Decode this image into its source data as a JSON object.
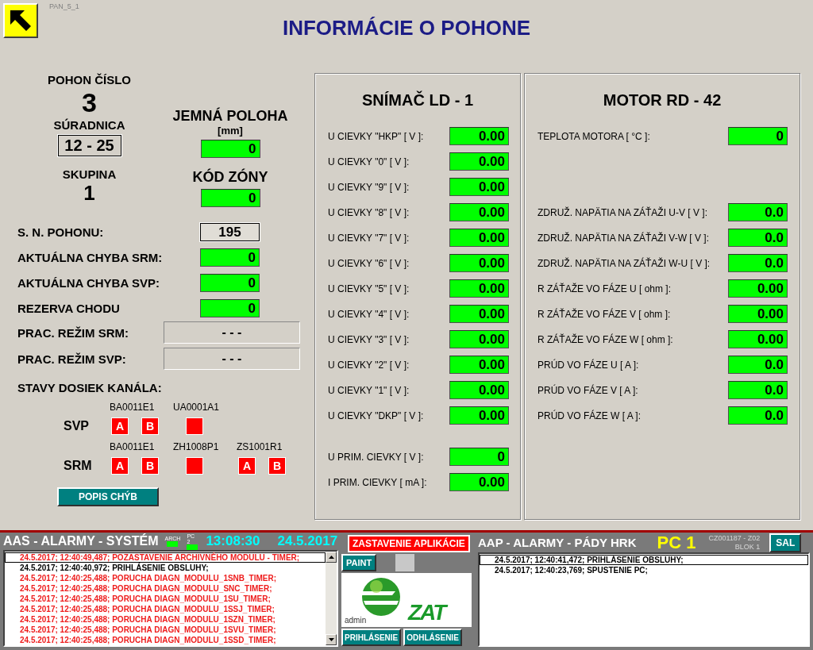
{
  "screen_id": "PAN_5_1",
  "title": "INFORMÁCIE O POHONE",
  "drive": {
    "number_label": "POHON ČÍSLO",
    "number": "3",
    "coord_label": "SÚRADNICA",
    "coord": "12 - 25",
    "group_label": "SKUPINA",
    "group": "1",
    "fine_label": "JEMNÁ POLOHA",
    "fine_unit": "[mm]",
    "fine_value": "0",
    "zone_label": "KÓD ZÓNY",
    "zone_value": "0"
  },
  "rows": [
    {
      "kind": "boxed",
      "label": "S. N.  POHONU:",
      "value": "195"
    },
    {
      "kind": "green",
      "label": "AKTUÁLNA CHYBA SRM:",
      "value": "0"
    },
    {
      "kind": "green",
      "label": "AKTUÁLNA CHYBA SVP:",
      "value": "0"
    },
    {
      "kind": "green",
      "label": "REZERVA  CHODU",
      "value": "0"
    },
    {
      "kind": "mode",
      "label": "PRAC. REŽIM SRM:",
      "value": "- - -"
    },
    {
      "kind": "mode",
      "label": "PRAC. REŽIM SVP:",
      "value": "- - -"
    }
  ],
  "boards": {
    "title": "STAVY DOSIEK KANÁLA:",
    "channels": [
      {
        "name": "SVP",
        "cards": [
          {
            "label": "BA0011E1",
            "indicators": [
              {
                "kind": "letter",
                "letter": "A"
              },
              {
                "kind": "letter",
                "letter": "B"
              }
            ]
          },
          {
            "label": "UA0001A1",
            "indicators": [
              {
                "kind": "blank"
              }
            ]
          }
        ]
      },
      {
        "name": "SRM",
        "cards": [
          {
            "label": "BA0011E1",
            "indicators": [
              {
                "kind": "letter",
                "letter": "A"
              },
              {
                "kind": "letter",
                "letter": "B"
              }
            ]
          },
          {
            "label": "ZH1008P1",
            "indicators": [
              {
                "kind": "blank"
              }
            ]
          },
          {
            "label": "ZS1001R1",
            "indicators": [
              {
                "kind": "letter",
                "letter": "A"
              },
              {
                "kind": "letter",
                "letter": "B"
              }
            ]
          }
        ]
      }
    ]
  },
  "error_button": "POPIS  CHÝB",
  "panels": [
    {
      "title": "SNÍMAČ LD - 1",
      "groups": [
        [
          {
            "label": "U CIEVKY  \"HKP\"  [ V ]:",
            "value": "0.00"
          },
          {
            "label": "U CIEVKY  \"0\"  [ V ]:",
            "value": "0.00"
          },
          {
            "label": "U CIEVKY  \"9\"  [ V ]:",
            "value": "0.00"
          },
          {
            "label": "U CIEVKY  \"8\"  [ V ]:",
            "value": "0.00"
          },
          {
            "label": "U CIEVKY  \"7\"  [ V ]:",
            "value": "0.00"
          },
          {
            "label": "U CIEVKY  \"6\"  [ V ]:",
            "value": "0.00"
          },
          {
            "label": "U CIEVKY  \"5\"  [ V ]:",
            "value": "0.00"
          },
          {
            "label": "U CIEVKY  \"4\"  [ V ]:",
            "value": "0.00"
          },
          {
            "label": "U CIEVKY  \"3\"  [ V ]:",
            "value": "0.00"
          },
          {
            "label": "U CIEVKY  \"2\"  [ V ]:",
            "value": "0.00"
          },
          {
            "label": "U CIEVKY  \"1\"  [ V ]:",
            "value": "0.00"
          },
          {
            "label": "U CIEVKY  \"DKP\"  [ V ]:",
            "value": "0.00"
          }
        ],
        [
          {
            "label": "U PRIM. CIEVKY  [ V ]:",
            "value": "0"
          },
          {
            "label": "I  PRIM. CIEVKY  [ mA ]:",
            "value": "0.00"
          }
        ]
      ]
    },
    {
      "title": "MOTOR RD - 42",
      "groups": [
        [
          {
            "label": "TEPLOTA MOTORA [ °C ]:",
            "value": "0"
          }
        ],
        [
          {
            "label": "ZDRUŽ. NAPÄTIA NA ZÁŤAŽI U-V [ V ]:",
            "value": "0.0"
          },
          {
            "label": "ZDRUŽ. NAPÄTIA NA ZÁŤAŽI V-W [ V ]:",
            "value": "0.0"
          },
          {
            "label": "ZDRUŽ. NAPÄTIA NA ZÁŤAŽI W-U [ V ]:",
            "value": "0.0"
          },
          {
            "label": "R ZÁŤAŽE VO FÁZE  U [ ohm ]:",
            "value": "0.00"
          },
          {
            "label": "R ZÁŤAŽE VO FÁZE  V [ ohm ]:",
            "value": "0.00"
          },
          {
            "label": "R ZÁŤAŽE VO FÁZE  W [ ohm ]:",
            "value": "0.00"
          },
          {
            "label": "PRÚD VO FÁZE  U [ A ]:",
            "value": "0.0"
          },
          {
            "label": "PRÚD VO FÁZE  V [ A ]:",
            "value": "0.0"
          },
          {
            "label": "PRÚD VO FÁZE  W [ A ]:",
            "value": "0.0"
          }
        ]
      ]
    }
  ],
  "alarms": {
    "title": "AAS - ALARMY - SYSTÉM",
    "indicators": [
      {
        "label": "ARCH",
        "on": true
      },
      {
        "label": "PC 2",
        "on": true
      }
    ],
    "time": "13:08:30",
    "date": "24.5.2017",
    "messages": [
      {
        "kind": "alarm",
        "selected": true,
        "text": "24.5.2017; 12:40:49,487; POZASTAVENIE ARCHIVNÉHO MODULU - TIMER;"
      },
      {
        "kind": "info",
        "selected": false,
        "text": "24.5.2017; 12:40:40,972; PRIHLÁSENIE OBSLUHY;"
      },
      {
        "kind": "alarm",
        "selected": false,
        "text": "24.5.2017; 12:40:25,488; PORUCHA DIAGN_MODULU_1SNB_TIMER;"
      },
      {
        "kind": "alarm",
        "selected": false,
        "text": "24.5.2017; 12:40:25,488; PORUCHA DIAGN_MODULU_SNC_TIMER;"
      },
      {
        "kind": "alarm",
        "selected": false,
        "text": "24.5.2017; 12:40:25,488; PORUCHA DIAGN_MODULU_1SU_TIMER;"
      },
      {
        "kind": "alarm",
        "selected": false,
        "text": "24.5.2017; 12:40:25,488; PORUCHA DIAGN_MODULU_1SSJ_TIMER;"
      },
      {
        "kind": "alarm",
        "selected": false,
        "text": "24.5.2017; 12:40:25,488; PORUCHA DIAGN_MODULU_1SZN_TIMER;"
      },
      {
        "kind": "alarm",
        "selected": false,
        "text": "24.5.2017; 12:40:25,488; PORUCHA DIAGN_MODULU_1SVU_TIMER;"
      },
      {
        "kind": "alarm",
        "selected": false,
        "text": "24.5.2017; 12:40:25,488; PORUCHA DIAGN_MODULU_1SSD_TIMER;"
      }
    ]
  },
  "controls": {
    "stop_button": "ZASTAVENIE  APLIKÁCIE",
    "paint_button": "PAINT",
    "user": "admin",
    "logo_text": "ZAT",
    "login_button": "PRIHLÁSENIE",
    "logout_button": "ODHLÁSENIE"
  },
  "falls": {
    "title": "AAP - ALARMY - PÁDY  HRK",
    "pc": "PC 1",
    "station": "CZ001187 - Z02",
    "block": "BLOK 1",
    "sal_button": "SAL",
    "messages": [
      {
        "selected": true,
        "text": "24.5.2017; 12:40:41,472; PRIHLÁSENIE OBSLUHY;"
      },
      {
        "selected": false,
        "text": "24.5.2017; 12:40:23,769; SPUSTENIE PC;"
      }
    ]
  }
}
